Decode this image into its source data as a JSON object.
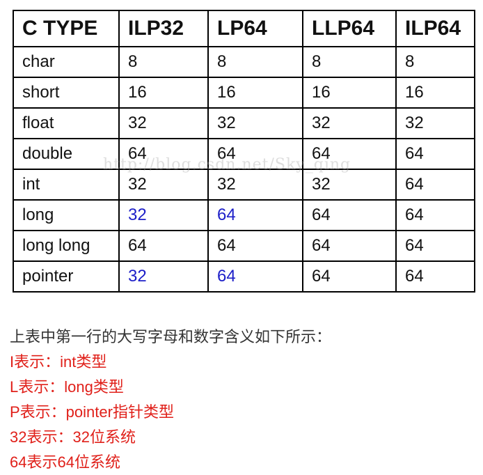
{
  "table": {
    "headers": [
      "C TYPE",
      "ILP32",
      "LP64",
      "LLP64",
      "ILP64"
    ],
    "rows": [
      {
        "type": "char",
        "values": [
          "8",
          "8",
          "8",
          "8"
        ]
      },
      {
        "type": "short",
        "values": [
          "16",
          "16",
          "16",
          "16"
        ]
      },
      {
        "type": "float",
        "values": [
          "32",
          "32",
          "32",
          "32"
        ]
      },
      {
        "type": "double",
        "values": [
          "64",
          "64",
          "64",
          "64"
        ]
      },
      {
        "type": "int",
        "values": [
          "32",
          "32",
          "32",
          "64"
        ]
      },
      {
        "type": "long",
        "values": [
          "32",
          "64",
          "64",
          "64"
        ]
      },
      {
        "type": "long long",
        "values": [
          "64",
          "64",
          "64",
          "64"
        ]
      },
      {
        "type": "pointer",
        "values": [
          "32",
          "64",
          "64",
          "64"
        ]
      }
    ],
    "highlight_color": "#1c1ec8"
  },
  "watermark": "http://blog.csdn.net/Sky_qing",
  "notes": {
    "intro": "上表中第一行的大写字母和数字含义如下所示：",
    "items": [
      "I表示：int类型",
      "L表示：long类型",
      "P表示：pointer指针类型",
      "32表示：32位系统",
      "64表示64位系统"
    ],
    "item_color": "#e0201a"
  }
}
